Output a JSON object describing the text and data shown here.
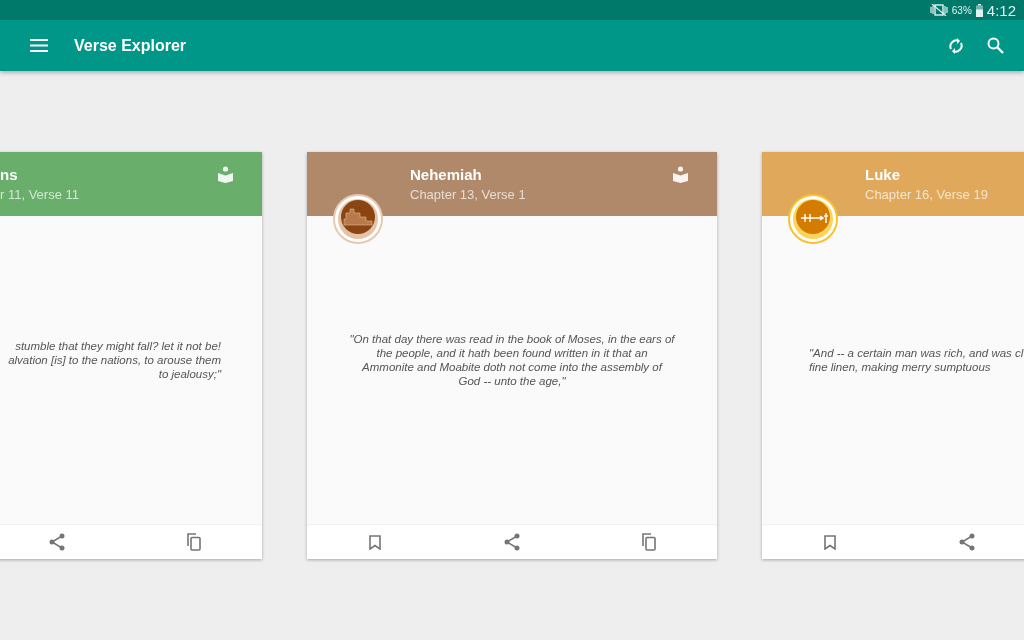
{
  "status_bar": {
    "battery": "63%",
    "time": "4:12"
  },
  "app_bar": {
    "title": "Verse Explorer"
  },
  "cards": [
    {
      "book": "ns",
      "reference": "r 11, Verse 11",
      "color": "#69ae6b",
      "verse": "stumble that they might fall? let it  not be!\nalvation [is] to the nations,  to arouse them\nto jealousy;\""
    },
    {
      "book": "Nehemiah",
      "reference": "Chapter 13, Verse 1",
      "color": "#b0896b",
      "kind": "wall",
      "verse": "\"On that day there was read in the book of Moses, in the  ears of\nthe people, and it hath been found written in it that  an\nAmmonite and Moabite doth not come into the assembly of\nGod  -- unto the age,\""
    },
    {
      "book": "Luke",
      "reference": "Chapter 16, Verse 19",
      "color": "#dfa85a",
      "kind": "timeline",
      "verse": "\"And -- a certain man was rich, and was cl\nfine linen, making merry sumptuous"
    }
  ]
}
